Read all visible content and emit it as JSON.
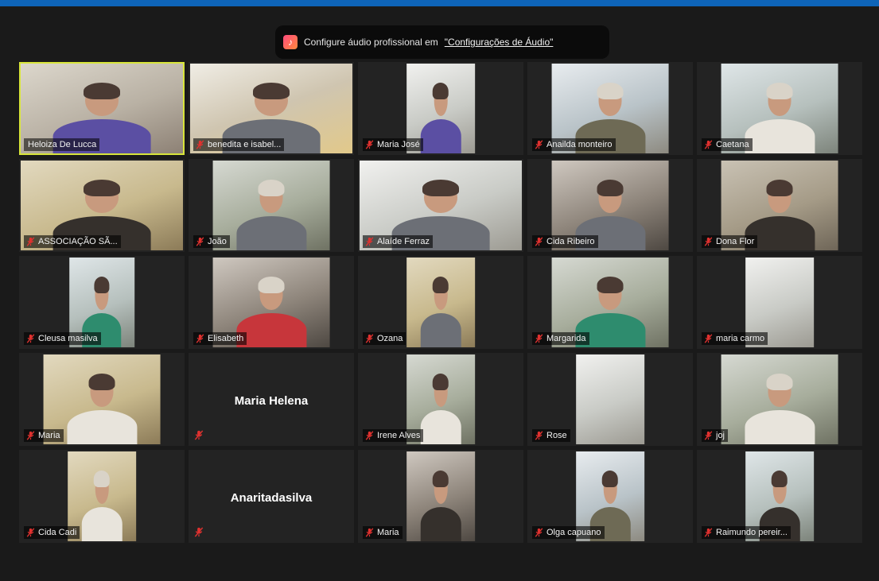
{
  "banner": {
    "text": "Configure áudio profissional em",
    "link": "\"Configurações de Áudio\"",
    "icon": "music-note-icon"
  },
  "colors": {
    "topbar": "#0e64b8",
    "background": "#1a1a1a",
    "active_speaker_border": "#d8e53a",
    "muted_icon": "#e0312f"
  },
  "participants": [
    {
      "name": "Heloiza De Lucca",
      "muted": false,
      "active": true,
      "video": true
    },
    {
      "name": "benedita e isabel...",
      "muted": true,
      "video": true
    },
    {
      "name": "Maria José",
      "muted": true,
      "video": true
    },
    {
      "name": "Anailda monteiro",
      "muted": true,
      "video": true
    },
    {
      "name": "Caetana",
      "muted": true,
      "video": true
    },
    {
      "name": "ASSOCIAÇÃO SÃ...",
      "muted": true,
      "video": true
    },
    {
      "name": "João",
      "muted": true,
      "video": true
    },
    {
      "name": "Alaíde Ferraz",
      "muted": true,
      "video": true
    },
    {
      "name": "Cida Ribeiro",
      "muted": true,
      "video": true
    },
    {
      "name": "Dona Flor",
      "muted": true,
      "video": true
    },
    {
      "name": "Cleusa masilva",
      "muted": true,
      "video": true
    },
    {
      "name": "Elisabeth",
      "muted": true,
      "video": true
    },
    {
      "name": "Ozana",
      "muted": true,
      "video": true
    },
    {
      "name": "Margarida",
      "muted": true,
      "video": true
    },
    {
      "name": "maria carmo",
      "muted": true,
      "video": true
    },
    {
      "name": "Maria",
      "muted": true,
      "video": true
    },
    {
      "name": "Maria Helena",
      "muted": true,
      "video": false
    },
    {
      "name": "Irene Alves",
      "muted": true,
      "video": true
    },
    {
      "name": "Rose",
      "muted": true,
      "video": true
    },
    {
      "name": "joj",
      "muted": true,
      "video": true
    },
    {
      "name": "Cida Cadi",
      "muted": true,
      "video": true
    },
    {
      "name": "Anaritadasilva",
      "muted": true,
      "video": false
    },
    {
      "name": "Maria",
      "muted": true,
      "video": true
    },
    {
      "name": "Olga capuano",
      "muted": true,
      "video": true
    },
    {
      "name": "Raimundo pereir...",
      "muted": true,
      "video": true
    }
  ]
}
